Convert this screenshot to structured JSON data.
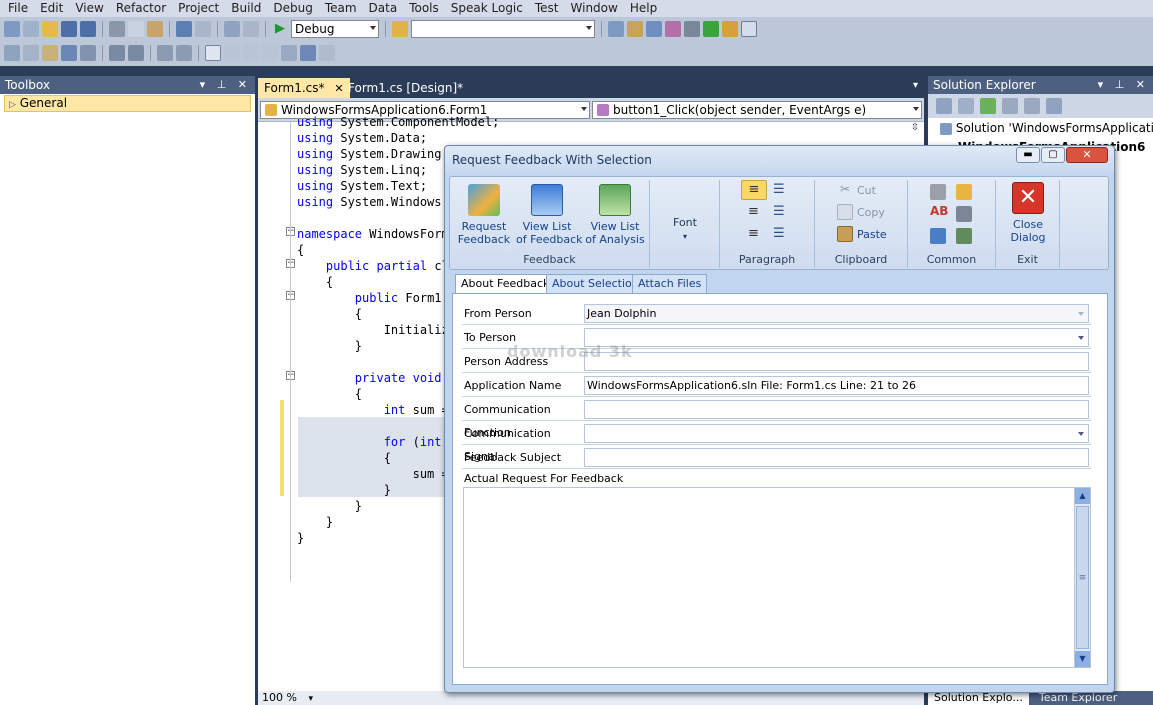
{
  "menu": [
    "File",
    "Edit",
    "View",
    "Refactor",
    "Project",
    "Build",
    "Debug",
    "Team",
    "Data",
    "Tools",
    "Speak Logic",
    "Test",
    "Window",
    "Help"
  ],
  "toolbar": {
    "config": "Debug",
    "search_value": ""
  },
  "toolbox": {
    "title": "Toolbox",
    "general": "General"
  },
  "tabs": {
    "form_cs": "Form1.cs*",
    "form_design": "Form1.cs [Design]*"
  },
  "nav": {
    "class": "WindowsFormsApplication6.Form1",
    "member": "button1_Click(object sender, EventArgs e)"
  },
  "code_lines": [
    "using System.ComponentModel;",
    "using System.Data;",
    "using System.Drawing;",
    "using System.Linq;",
    "using System.Text;",
    "using System.Windows.",
    "",
    "namespace WindowsForm",
    "{",
    "    public partial cl",
    "    {",
    "        public Form1(",
    "        {",
    "            Initializ",
    "        }",
    "",
    "        private void ",
    "        {",
    "            int sum =",
    "",
    "            for (int ",
    "            {",
    "                sum =",
    "            }",
    "        }",
    "    }",
    "}"
  ],
  "zoom": "100 %",
  "solution": {
    "title": "Solution Explorer",
    "root": "Solution 'WindowsFormsApplication",
    "project": "WindowsFormsApplication6",
    "tab1": "Solution Explo...",
    "tab2": "Team Explorer"
  },
  "dialog": {
    "title": "Request Feedback With Selection",
    "ribbon": {
      "request": "Request\nFeedback",
      "view_feedback": "View List\nof Feedback",
      "view_analysis": "View List\nof Analysis",
      "group_feedback": "Feedback",
      "font": "Font",
      "group_paragraph": "Paragraph",
      "cut": "Cut",
      "copy": "Copy",
      "paste": "Paste",
      "group_clipboard": "Clipboard",
      "group_common": "Common",
      "close": "Close\nDialog",
      "group_exit": "Exit"
    },
    "tabs": [
      "About Feedback",
      "About Selection",
      "Attach Files"
    ],
    "fields": [
      {
        "label": "From Person",
        "value": "Jean Dolphin"
      },
      {
        "label": "To Person",
        "value": ""
      },
      {
        "label": "Person Address",
        "value": ""
      },
      {
        "label": "Application Name",
        "value": "WindowsFormsApplication6.sln  File: Form1.cs  Line: 21 to 26"
      },
      {
        "label": "Communication Function",
        "value": ""
      },
      {
        "label": "Communication Signal",
        "value": ""
      },
      {
        "label": "Feedback Subject",
        "value": ""
      }
    ],
    "actual_label": "Actual Request For Feedback",
    "actual_value": "",
    "watermark": "download 3k"
  }
}
